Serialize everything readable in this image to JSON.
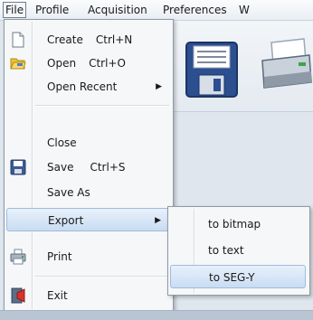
{
  "menubar": {
    "items": [
      {
        "label": "File"
      },
      {
        "label": "Profile"
      },
      {
        "label": "Acquisition"
      },
      {
        "label": "Preferences"
      },
      {
        "label": "W"
      }
    ]
  },
  "file_menu": {
    "items": [
      {
        "label": "Create",
        "shortcut": "Ctrl+N",
        "icon": "new-document-icon"
      },
      {
        "label": "Open",
        "shortcut": "Ctrl+O",
        "icon": "open-folder-icon"
      },
      {
        "label": "Open Recent",
        "submenu_arrow": "▶"
      },
      {
        "label": "Close"
      },
      {
        "label": "Save",
        "shortcut": "Ctrl+S",
        "icon": "save-floppy-icon"
      },
      {
        "label": "Save As"
      },
      {
        "label": "Export",
        "submenu_arrow": "▶"
      },
      {
        "label": "Print",
        "icon": "printer-icon"
      },
      {
        "label": "Exit",
        "icon": "exit-icon"
      }
    ]
  },
  "export_submenu": {
    "items": [
      {
        "label": "to bitmap"
      },
      {
        "label": "to text"
      },
      {
        "label": "to SEG-Y"
      }
    ]
  },
  "toolbar": {
    "icons": [
      "save-floppy-icon",
      "printer-icon"
    ]
  }
}
